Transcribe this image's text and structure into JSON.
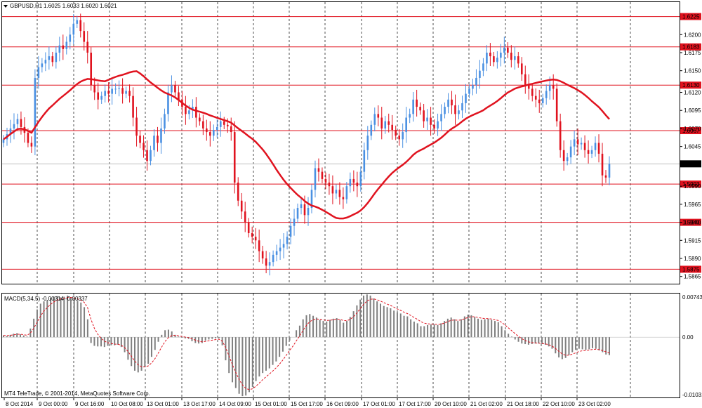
{
  "header": {
    "symbol_menu_icon": "triangle-down-icon",
    "symbol": "GBPUSD,H1",
    "ohlc": "1.6025 1.6033 1.6020 1.6021"
  },
  "macd": {
    "label": "MACD(5,34,5) -0.00314 -0.00337",
    "ylabels": [
      "0.00743",
      "0.00",
      "-0.01031"
    ],
    "values": [
      0.0003,
      0.0002,
      0.0004,
      0.0006,
      0.0007,
      0.0005,
      0.0003,
      0.0001,
      0.0015,
      0.0032,
      0.0048,
      0.0058,
      0.0062,
      0.0064,
      0.0068,
      0.007,
      0.0071,
      0.0069,
      0.007,
      0.0072,
      0.0069,
      0.0066,
      0.0063,
      0.006,
      0.0052,
      0.0031,
      -0.001,
      -0.0015,
      -0.0016,
      -0.0016,
      -0.0017,
      -0.0015,
      -0.0014,
      -0.0014,
      -0.0013,
      -0.0017,
      -0.0026,
      -0.0039,
      -0.005,
      -0.0058,
      -0.0061,
      -0.0058,
      -0.0052,
      -0.0046,
      -0.0034,
      -0.0022,
      -0.0008,
      0.0004,
      0.0012,
      0.0013,
      0.001,
      0.0004,
      0.0001,
      -0.0001,
      -0.0002,
      -0.0003,
      -0.0007,
      -0.001,
      -0.0011,
      -0.001,
      -0.0006,
      -0.0004,
      -0.0003,
      -0.0002,
      -0.0002,
      -0.0014,
      -0.004,
      -0.0062,
      -0.0078,
      -0.0088,
      -0.0098,
      -0.0102,
      -0.0101,
      -0.0095,
      -0.0086,
      -0.0076,
      -0.0068,
      -0.0062,
      -0.0058,
      -0.0054,
      -0.0048,
      -0.0042,
      -0.0034,
      -0.0025,
      -0.0015,
      -0.0006,
      0.0,
      0.0012,
      0.002,
      0.0031,
      0.0038,
      0.004,
      0.0037,
      0.0034,
      0.003,
      0.0028,
      0.0027,
      0.003,
      0.0032,
      0.0033,
      0.003,
      0.0025,
      0.0028,
      0.0035,
      0.0045,
      0.0055,
      0.0065,
      0.0072,
      0.0074,
      0.0072,
      0.0067,
      0.0062,
      0.0058,
      0.0054,
      0.0052,
      0.005,
      0.0046,
      0.0043,
      0.0041,
      0.0037,
      0.0036,
      0.0031,
      0.0027,
      0.0024,
      0.0019,
      0.0019,
      0.0021,
      0.0022,
      0.0022,
      0.0021,
      0.0024,
      0.0028,
      0.0032,
      0.0034,
      0.0031,
      0.0028,
      0.0031,
      0.0036,
      0.0039,
      0.0038,
      0.0035,
      0.0032,
      0.003,
      0.0031,
      0.0032,
      0.003,
      0.0028,
      0.0026,
      0.0019,
      0.0012,
      0.0006,
      0.0001,
      -0.0004,
      -0.0008,
      -0.0011,
      -0.0012,
      -0.0013,
      -0.0012,
      -0.0011,
      -0.0011,
      -0.0012,
      -0.0013,
      -0.0016,
      -0.002,
      -0.0028,
      -0.0035,
      -0.0038,
      -0.0036,
      -0.0031,
      -0.0026,
      -0.0022,
      -0.002,
      -0.0021,
      -0.0022,
      -0.0021,
      -0.0019,
      -0.002,
      -0.0023,
      -0.0026,
      -0.003,
      -0.0031
    ]
  },
  "footer": {
    "copyright": "MT4 TeleTrade, © 2001-2014, MetaQuotes Software Corp."
  },
  "colors": {
    "up": "#4a90e2",
    "down": "#e0131f",
    "ma": "#e0131f",
    "level": "#e0131f",
    "grid": "#222222",
    "hist": "#7f7f7f",
    "signal": "#e0131f"
  },
  "chart_data": {
    "type": "candlestick",
    "y_ticks": [
      "1.6200",
      "1.6175",
      "1.6150",
      "1.6120",
      "1.6095",
      "1.6070",
      "1.6045",
      "1.6020",
      "1.5990",
      "1.5965",
      "1.5940",
      "1.5915",
      "1.5890",
      "1.5865"
    ],
    "levels": [
      {
        "value": 1.6225,
        "label": "1.6225"
      },
      {
        "value": 1.6183,
        "label": "1.6183"
      },
      {
        "value": 1.613,
        "label": "1.6130"
      },
      {
        "value": 1.6067,
        "label": "1.6067"
      },
      {
        "value": 1.5993,
        "label": "1.5993"
      },
      {
        "value": 1.594,
        "label": "1.5940"
      },
      {
        "value": 1.5875,
        "label": "1.5875"
      }
    ],
    "current_price": "1.6021",
    "x_labels": [
      "8 Oct 2014",
      "9 Oct 00:00",
      "9 Oct 16:00",
      "10 Oct 08:00",
      "13 Oct 01:00",
      "13 Oct 17:00",
      "14 Oct 09:00",
      "15 Oct 01:00",
      "15 Oct 17:00",
      "16 Oct 09:00",
      "17 Oct 01:00",
      "17 Oct 17:00",
      "20 Oct 10:00",
      "21 Oct 02:00",
      "21 Oct 18:00",
      "22 Oct 10:00",
      "23 Oct 02:00"
    ],
    "closes": [
      1.6055,
      1.6062,
      1.607,
      1.6076,
      1.6083,
      1.6072,
      1.6064,
      1.605,
      1.6045,
      1.614,
      1.6155,
      1.616,
      1.6165,
      1.617,
      1.6162,
      1.6175,
      1.6185,
      1.618,
      1.619,
      1.62,
      1.6215,
      1.622,
      1.6205,
      1.619,
      1.6175,
      1.613,
      1.612,
      1.611,
      1.6115,
      1.6122,
      1.6118,
      1.6125,
      1.6125,
      1.6126,
      1.6118,
      1.6122,
      1.6115,
      1.6085,
      1.606,
      1.605,
      1.604,
      1.6025,
      1.604,
      1.606,
      1.605,
      1.607,
      1.609,
      1.612,
      1.613,
      1.612,
      1.611,
      1.61,
      1.609,
      1.6095,
      1.61,
      1.6085,
      1.608,
      1.607,
      1.6065,
      1.606,
      1.6068,
      1.6072,
      1.608,
      1.6075,
      1.6073,
      1.6065,
      1.5995,
      1.597,
      1.5955,
      1.594,
      1.5925,
      1.592,
      1.5915,
      1.59,
      1.589,
      1.588,
      1.5885,
      1.5895,
      1.59,
      1.5905,
      1.591,
      1.592,
      1.5935,
      1.5945,
      1.596,
      1.5965,
      1.595,
      1.596,
      1.5985,
      1.6015,
      1.601,
      1.6,
      1.5995,
      1.599,
      1.598,
      1.5985,
      1.5975,
      1.5972,
      1.599,
      1.6,
      1.5995,
      1.599,
      1.601,
      1.604,
      1.606,
      1.6075,
      1.609,
      1.6085,
      1.607,
      1.608,
      1.6075,
      1.6068,
      1.606,
      1.6055,
      1.6065,
      1.6085,
      1.609,
      1.611,
      1.61,
      1.6095,
      1.608,
      1.6085,
      1.6075,
      1.607,
      1.608,
      1.609,
      1.61,
      1.611,
      1.6102,
      1.609,
      1.6095,
      1.6105,
      1.6118,
      1.6125,
      1.613,
      1.614,
      1.615,
      1.616,
      1.6175,
      1.617,
      1.6162,
      1.6168,
      1.6175,
      1.6182,
      1.6175,
      1.6165,
      1.617,
      1.616,
      1.6145,
      1.613,
      1.6125,
      1.6115,
      1.611,
      1.6105,
      1.6112,
      1.6122,
      1.613,
      1.6125,
      1.608,
      1.604,
      1.6025,
      1.603,
      1.6045,
      1.6055,
      1.6048,
      1.605,
      1.604,
      1.6035,
      1.604,
      1.605,
      1.6035,
      1.6005,
      1.6002,
      1.6021
    ]
  }
}
